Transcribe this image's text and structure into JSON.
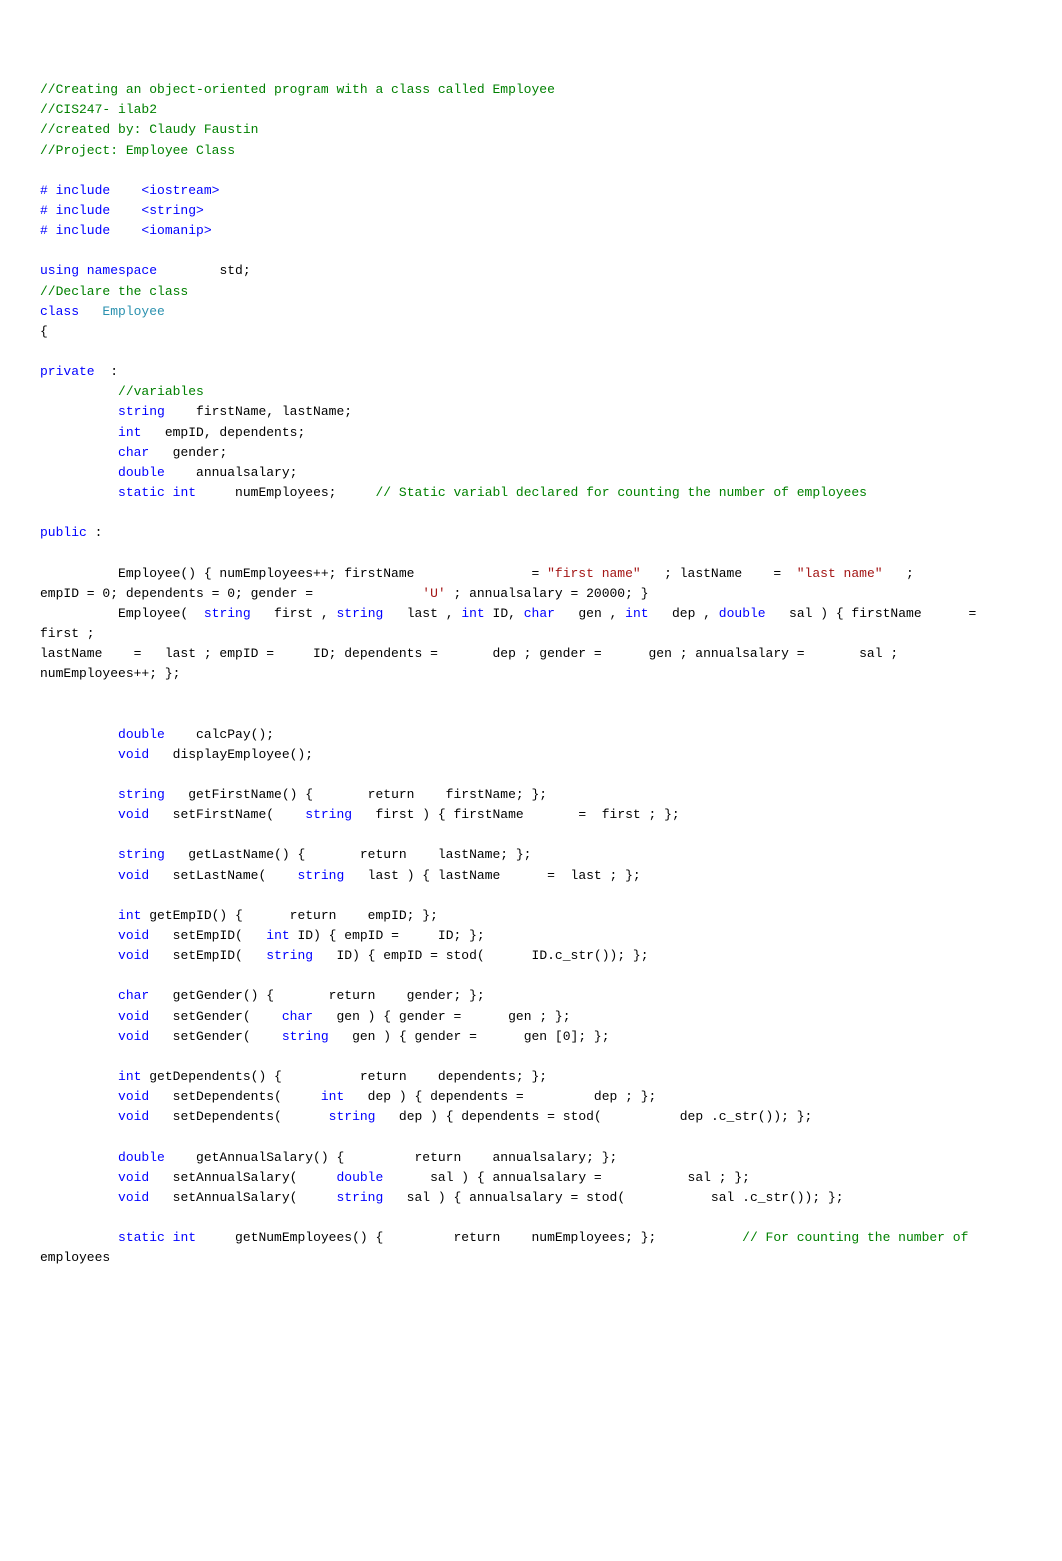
{
  "code": {
    "lines": []
  }
}
